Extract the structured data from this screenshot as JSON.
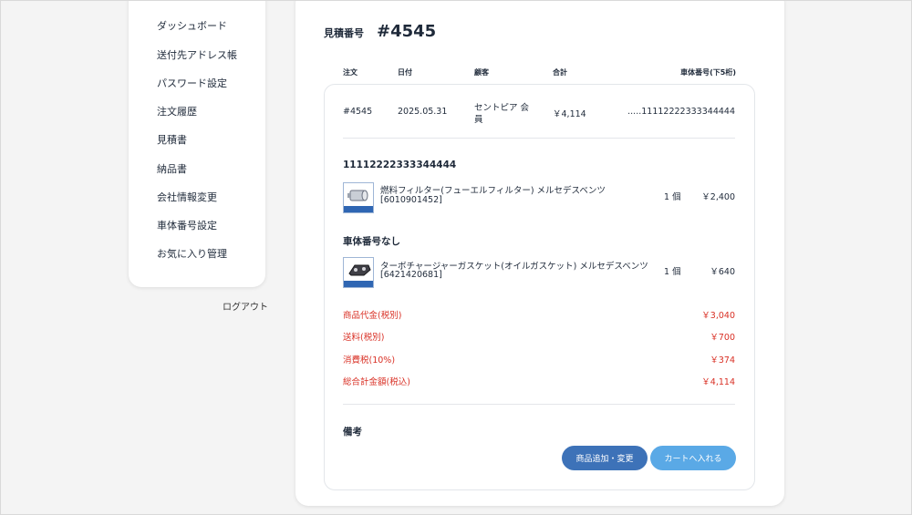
{
  "sidebar": {
    "items": [
      {
        "label": "ダッシュボード"
      },
      {
        "label": "送付先アドレス帳"
      },
      {
        "label": "パスワード設定"
      },
      {
        "label": "注文履歴"
      },
      {
        "label": "見積書"
      },
      {
        "label": "納品書"
      },
      {
        "label": "会社情報変更"
      },
      {
        "label": "車体番号設定"
      },
      {
        "label": "お気に入り管理"
      }
    ],
    "logout_label": "ログアウト"
  },
  "quote": {
    "label": "見積番号",
    "number": "#4545"
  },
  "table": {
    "headers": {
      "order": "注文",
      "date": "日付",
      "customer": "顧客",
      "total": "合計",
      "vin": "車体番号(下5桁)"
    },
    "row": {
      "order": "#4545",
      "date": "2025.05.31",
      "customer_line1": "セントピア 会",
      "customer_line2": "員",
      "total": "￥4,114",
      "vin": ".....11112222333344444"
    }
  },
  "groups": [
    {
      "title": "11112222333344444",
      "items": [
        {
          "name": "燃料フィルター(フューエルフィルター) メルセデスベンツ",
          "code": "[6010901452]",
          "qty": "1 個",
          "price": "￥2,400",
          "thumb_icon": "fuel-filter-icon"
        }
      ]
    },
    {
      "title": "車体番号なし",
      "items": [
        {
          "name": "ターボチャージャーガスケット(オイルガスケット) メルセデスベンツ",
          "code": "[6421420681]",
          "qty": "1 個",
          "price": "￥640",
          "thumb_icon": "gasket-icon"
        }
      ]
    }
  ],
  "summary": [
    {
      "label": "商品代金(税別)",
      "value": "￥3,040"
    },
    {
      "label": "送料(税別)",
      "value": "￥700"
    },
    {
      "label": "消費税(10%)",
      "value": "￥374"
    },
    {
      "label": "総合計金額(税込)",
      "value": "￥4,114"
    }
  ],
  "notes": {
    "title": "備考"
  },
  "buttons": {
    "add_change": "商品追加・変更",
    "add_to_cart": "カートへ入れる"
  },
  "colors": {
    "accent_dark": "#3d72b8",
    "accent_light": "#5aa9e6",
    "summary_red": "#d93025"
  }
}
